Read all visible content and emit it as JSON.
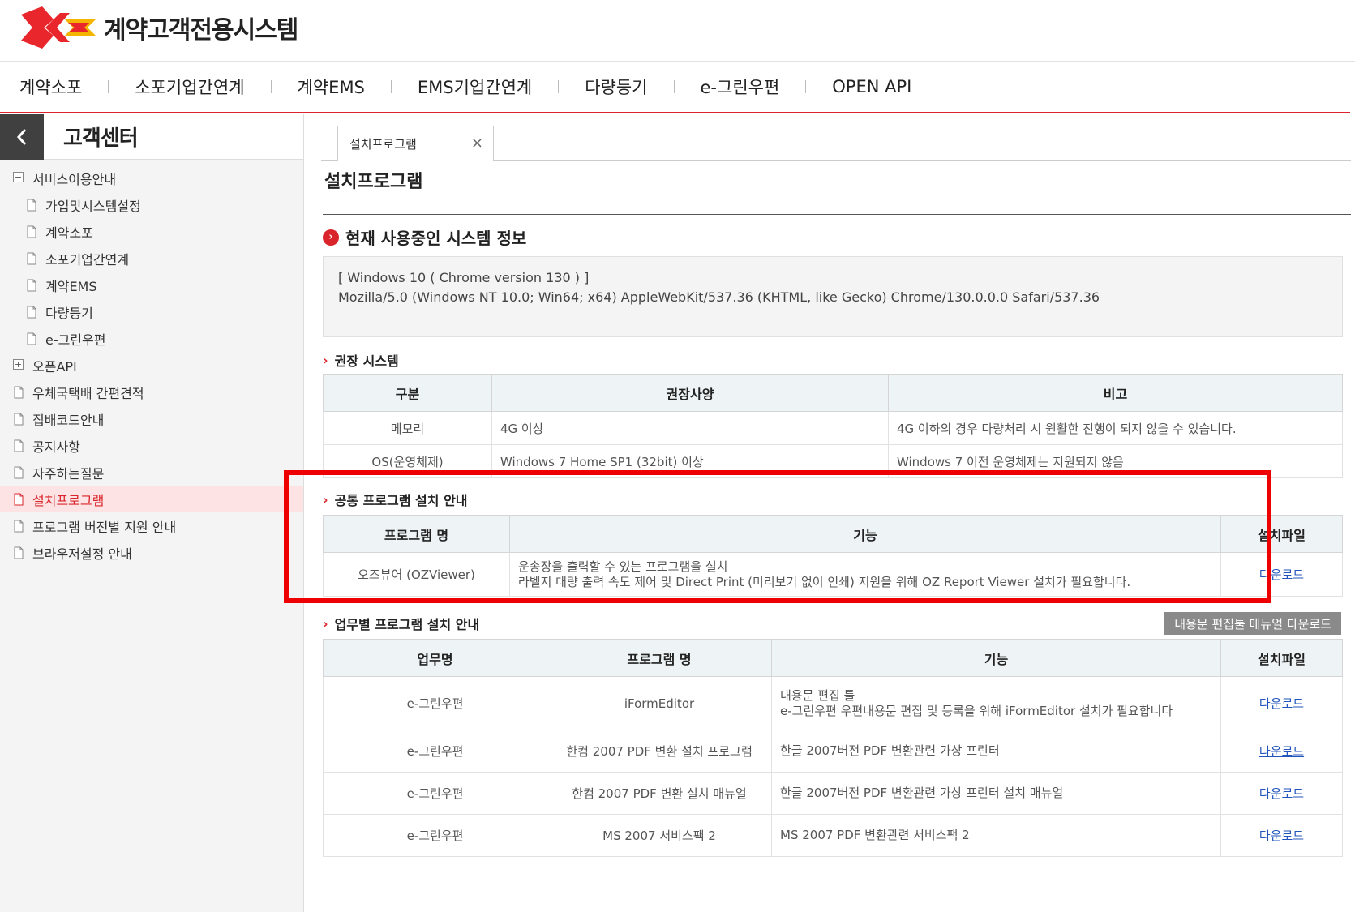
{
  "header": {
    "app_title": "계약고객전용시스템"
  },
  "topnav": [
    "계약소포",
    "소포기업간연계",
    "계약EMS",
    "EMS기업간연계",
    "다량등기",
    "e-그린우편",
    "OPEN API"
  ],
  "sidebar": {
    "title": "고객센터",
    "items": [
      {
        "label": "서비스이용안내",
        "level": 0,
        "icon": "minus-box-icon"
      },
      {
        "label": "가입및시스템설정",
        "level": 1,
        "icon": "page-icon"
      },
      {
        "label": "계약소포",
        "level": 1,
        "icon": "page-icon"
      },
      {
        "label": "소포기업간연계",
        "level": 1,
        "icon": "page-icon"
      },
      {
        "label": "계약EMS",
        "level": 1,
        "icon": "page-icon"
      },
      {
        "label": "다량등기",
        "level": 1,
        "icon": "page-icon"
      },
      {
        "label": "e-그린우편",
        "level": 1,
        "icon": "page-icon"
      },
      {
        "label": "오픈API",
        "level": 0,
        "icon": "plus-box-icon"
      },
      {
        "label": "우체국택배 간편견적",
        "level": 0,
        "icon": "page-icon"
      },
      {
        "label": "집배코드안내",
        "level": 0,
        "icon": "page-icon"
      },
      {
        "label": "공지사항",
        "level": 0,
        "icon": "page-icon"
      },
      {
        "label": "자주하는질문",
        "level": 0,
        "icon": "page-icon"
      },
      {
        "label": "설치프로그램",
        "level": 0,
        "icon": "page-icon",
        "active": true
      },
      {
        "label": "프로그램 버전별 지원 안내",
        "level": 0,
        "icon": "page-icon"
      },
      {
        "label": "브라우저설정 안내",
        "level": 0,
        "icon": "page-icon"
      }
    ]
  },
  "tab": {
    "label": "설치프로그램",
    "close": "×"
  },
  "page_title": "설치프로그램",
  "system_info": {
    "title": "현재 사용중인 시스템 정보",
    "line1": "[ Windows 10 ( Chrome version 130 ) ]",
    "line2": "Mozilla/5.0 (Windows NT 10.0; Win64; x64) AppleWebKit/537.36 (KHTML, like Gecko) Chrome/130.0.0.0 Safari/537.36"
  },
  "recommended": {
    "title": "권장 시스템",
    "headers": [
      "구분",
      "권장사양",
      "비고"
    ],
    "rows": [
      [
        "메모리",
        "4G 이상",
        "4G 이하의 경우 다량처리 시 원활한 진행이 되지 않을 수 있습니다."
      ],
      [
        "OS(운영체제)",
        "Windows 7 Home SP1 (32bit) 이상",
        "Windows 7 이전 운영체제는 지원되지 않음"
      ]
    ]
  },
  "common": {
    "title": "공통 프로그램 설치 안내",
    "headers": [
      "프로그램 명",
      "기능",
      "설치파일"
    ],
    "row": {
      "name": "오즈뷰어 (OZViewer)",
      "func1": "운송장을 출력할 수 있는 프로그램을 설치",
      "func2": "라벨지 대량 출력 속도 제어 및 Direct Print (미리보기 없이 인쇄) 지원을 위해 OZ Report Viewer 설치가 필요합니다.",
      "download": "다운로드"
    }
  },
  "business": {
    "title": "업무별 프로그램 설치 안내",
    "manual_button": "내용문 편집툴 매뉴얼 다운로드",
    "headers": [
      "업무명",
      "프로그램 명",
      "기능",
      "설치파일"
    ],
    "rows": [
      {
        "task": "e-그린우편",
        "program": "iFormEditor",
        "func1": "내용문 편집 툴",
        "func2": "e-그린우편 우편내용문 편집 및 등록을 위해 iFormEditor 설치가 필요합니다",
        "download": "다운로드"
      },
      {
        "task": "e-그린우편",
        "program": "한컴 2007 PDF 변환 설치 프로그램",
        "func1": "한글 2007버전 PDF 변환관련 가상 프린터",
        "func2": "",
        "download": "다운로드"
      },
      {
        "task": "e-그린우편",
        "program": "한컴 2007 PDF 변환 설치 매뉴얼",
        "func1": "한글 2007버전 PDF 변환관련 가상 프린터 설치 매뉴얼",
        "func2": "",
        "download": "다운로드"
      },
      {
        "task": "e-그린우편",
        "program": "MS 2007 서비스팩 2",
        "func1": "MS 2007 PDF 변환관련 서비스팩 2",
        "func2": "",
        "download": "다운로드"
      }
    ]
  },
  "colors": {
    "accent": "#d9242b",
    "highlight": "#ee0000",
    "link": "#2255bb"
  }
}
